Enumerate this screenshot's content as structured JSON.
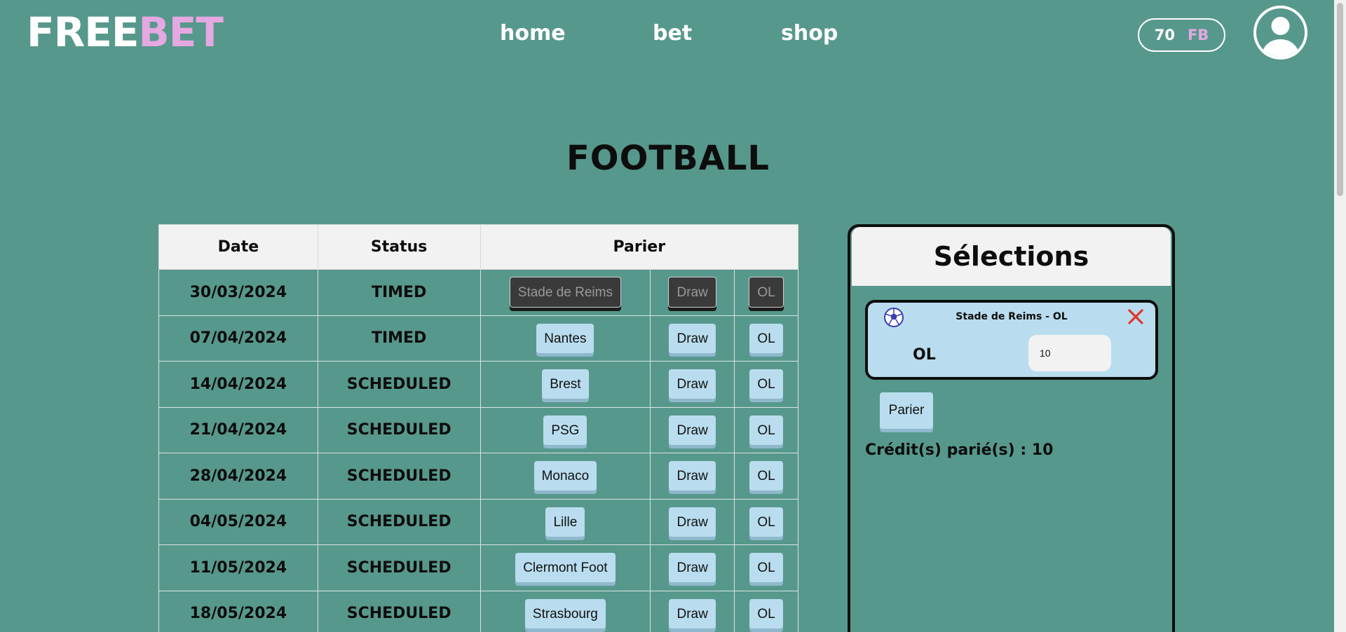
{
  "header": {
    "logo_free": "FREE",
    "logo_bet": "BET",
    "nav": [
      "home",
      "bet",
      "shop"
    ],
    "credits_amount": "70",
    "credits_unit": "FB"
  },
  "page_title": "FOOTBALL",
  "table": {
    "headers": [
      "Date",
      "Status",
      "Parier"
    ],
    "rows": [
      {
        "date": "30/03/2024",
        "status": "TIMED",
        "home": "Stade de Reims",
        "draw": "Draw",
        "away": "OL",
        "disabled": true
      },
      {
        "date": "07/04/2024",
        "status": "TIMED",
        "home": "Nantes",
        "draw": "Draw",
        "away": "OL",
        "disabled": false
      },
      {
        "date": "14/04/2024",
        "status": "SCHEDULED",
        "home": "Brest",
        "draw": "Draw",
        "away": "OL",
        "disabled": false
      },
      {
        "date": "21/04/2024",
        "status": "SCHEDULED",
        "home": "PSG",
        "draw": "Draw",
        "away": "OL",
        "disabled": false
      },
      {
        "date": "28/04/2024",
        "status": "SCHEDULED",
        "home": "Monaco",
        "draw": "Draw",
        "away": "OL",
        "disabled": false
      },
      {
        "date": "04/05/2024",
        "status": "SCHEDULED",
        "home": "Lille",
        "draw": "Draw",
        "away": "OL",
        "disabled": false
      },
      {
        "date": "11/05/2024",
        "status": "SCHEDULED",
        "home": "Clermont Foot",
        "draw": "Draw",
        "away": "OL",
        "disabled": false
      },
      {
        "date": "18/05/2024",
        "status": "SCHEDULED",
        "home": "Strasbourg",
        "draw": "Draw",
        "away": "OL",
        "disabled": false
      }
    ]
  },
  "selections": {
    "title": "Sélections",
    "items": [
      {
        "match": "Stade de Reims - OL",
        "pick": "OL",
        "amount": "10",
        "icon": "soccer-ball-icon"
      }
    ],
    "submit_label": "Parier",
    "credit_total": "Crédit(s) parié(s) : 10"
  }
}
